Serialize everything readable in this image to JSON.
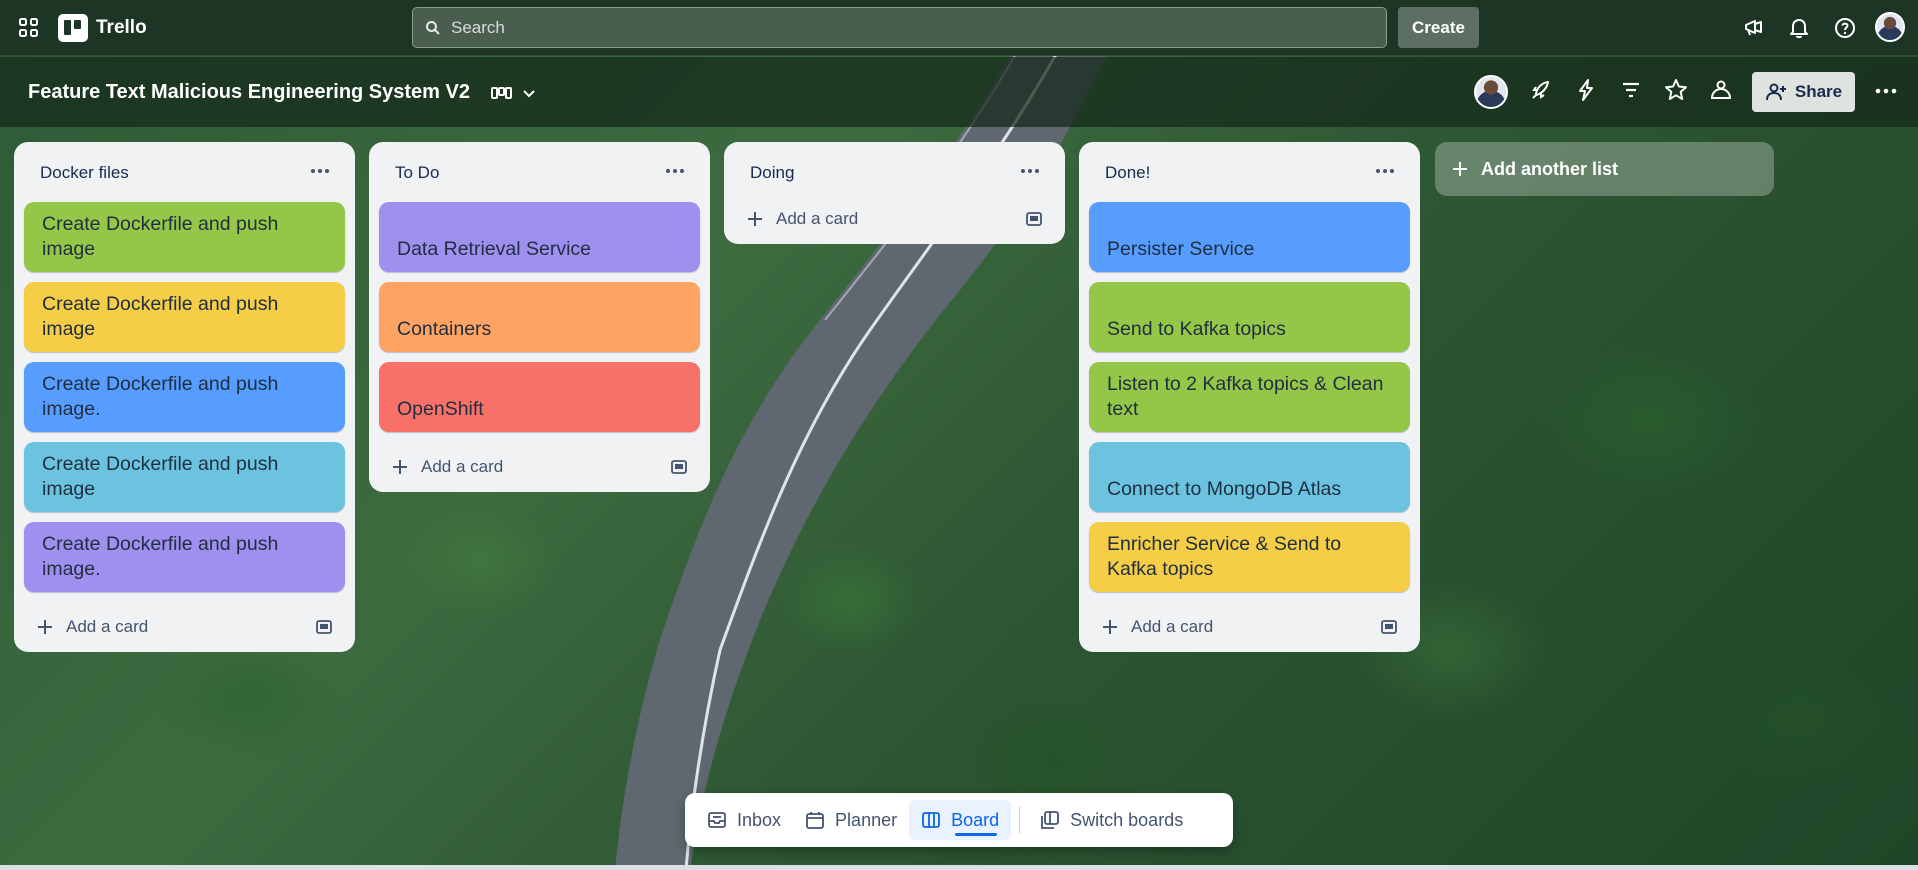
{
  "topnav": {
    "app_name": "Trello",
    "search_placeholder": "Search",
    "create_label": "Create"
  },
  "board": {
    "title": "Feature Text Malicious Engineering System V2",
    "share_label": "Share"
  },
  "lists": [
    {
      "title": "Docker files",
      "cards": [
        {
          "text": "Create Dockerfile and push image",
          "color": "#94c748"
        },
        {
          "text": "Create Dockerfile and push image",
          "color": "#f5cd47"
        },
        {
          "text": "Create Dockerfile and push image.",
          "color": "#579dff"
        },
        {
          "text": "Create Dockerfile and push image",
          "color": "#6cc3e0"
        },
        {
          "text": "Create Dockerfile and push image.",
          "color": "#9f8fef"
        }
      ],
      "add_card_label": "Add a card"
    },
    {
      "title": "To Do",
      "cards": [
        {
          "text": "Data Retrieval Service",
          "color": "#9f8fef"
        },
        {
          "text": "Containers",
          "color": "#fea362"
        },
        {
          "text": "OpenShift",
          "color": "#f87168"
        }
      ],
      "add_card_label": "Add a card"
    },
    {
      "title": "Doing",
      "cards": [],
      "add_card_label": "Add a card"
    },
    {
      "title": "Done!",
      "cards": [
        {
          "text": "Persister Service",
          "color": "#579dff"
        },
        {
          "text": "Send to Kafka topics",
          "color": "#94c748"
        },
        {
          "text": "Listen to 2 Kafka topics & Clean text",
          "color": "#94c748"
        },
        {
          "text": "Connect to MongoDB Atlas",
          "color": "#6cc3e0"
        },
        {
          "text": "Enricher Service & Send to Kafka topics",
          "color": "#f5cd47"
        }
      ],
      "add_card_label": "Add a card"
    }
  ],
  "add_list_label": "Add another list",
  "bottom_nav": {
    "inbox": "Inbox",
    "planner": "Planner",
    "board": "Board",
    "switch_boards": "Switch boards"
  }
}
